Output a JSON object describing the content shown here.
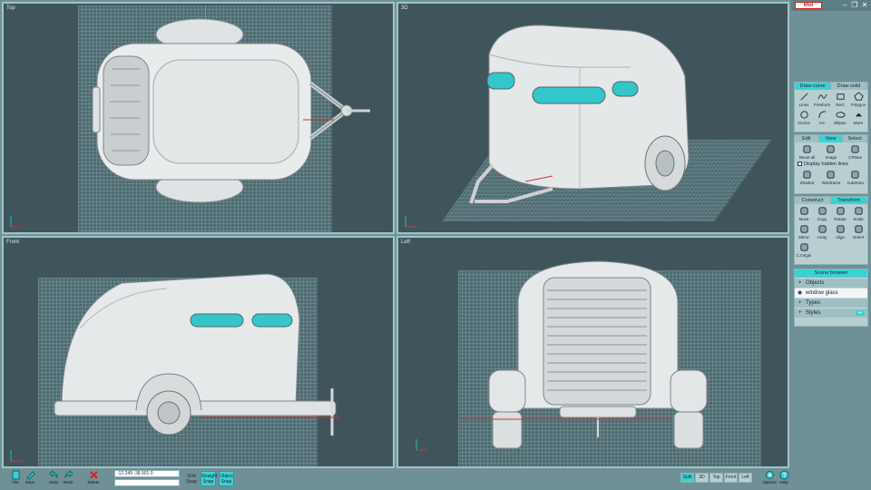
{
  "viewports": {
    "top": {
      "label": "Top"
    },
    "persp": {
      "label": "3D"
    },
    "front": {
      "label": "Front"
    },
    "left": {
      "label": "Left"
    }
  },
  "panel": {
    "app_logo": "MoI",
    "draw_tabs": [
      "Draw curve",
      "Draw solid"
    ],
    "draw_tools": [
      {
        "label": "Lines",
        "icon": "lines-icon"
      },
      {
        "label": "Freeform",
        "icon": "freeform-icon"
      },
      {
        "label": "Rect",
        "icon": "rect-icon"
      },
      {
        "label": "Polygon",
        "icon": "polygon-icon"
      },
      {
        "label": "Circles",
        "icon": "circles-icon"
      },
      {
        "label": "Arc",
        "icon": "arc-icon"
      },
      {
        "label": "Ellipse",
        "icon": "ellipse-icon"
      },
      {
        "label": "More",
        "icon": "more-icon"
      }
    ],
    "view_tabs": [
      "Edit",
      "View",
      "Select"
    ],
    "view_tools": [
      {
        "label": "Reset all",
        "icon": "reset-all-icon"
      },
      {
        "label": "Image",
        "icon": "image-icon"
      },
      {
        "label": "CPlane",
        "icon": "cplane-icon"
      }
    ],
    "display_hidden_lines": "Display hidden lines",
    "render_tools": [
      {
        "label": "Shaded",
        "icon": "shaded-icon"
      },
      {
        "label": "Wireframe",
        "icon": "wireframe-icon"
      },
      {
        "label": "AutoRoto",
        "icon": "autorotate-icon"
      }
    ],
    "transform_tabs": [
      "Construct",
      "Transform"
    ],
    "transform_tools": [
      {
        "label": "Move",
        "icon": "move-icon"
      },
      {
        "label": "Copy",
        "icon": "copy-icon"
      },
      {
        "label": "Rotate",
        "icon": "rotate-icon"
      },
      {
        "label": "Scale",
        "icon": "scale-icon"
      },
      {
        "label": "Mirror",
        "icon": "mirror-icon"
      },
      {
        "label": "Array",
        "icon": "array-icon"
      },
      {
        "label": "Align",
        "icon": "align-icon"
      },
      {
        "label": "Orient",
        "icon": "orient-icon"
      },
      {
        "label": "C.Origin",
        "icon": "c-origin-icon"
      }
    ],
    "scene_browser": {
      "title": "Scene browser",
      "objects": "Objects",
      "selected_item": "window glass",
      "types": "Types",
      "styles": "Styles"
    }
  },
  "bottom": {
    "file": "File",
    "save": "Save",
    "undo": "Undo",
    "redo": "Redo",
    "delete": "Delete",
    "coords": "-12.249   -38.901   0",
    "grid_snap": "Grid Snap",
    "straight_snap": "Straight Snap",
    "object_snap": "Object Snap",
    "view_buttons": [
      "Split",
      "3D",
      "Top",
      "Front",
      "Left"
    ],
    "active_view": "Split",
    "options": "Options",
    "help": "Help"
  },
  "colors": {
    "accent": "#39d3d6",
    "viewport_bg": "#3f555b",
    "panel_bg": "#6f9096"
  }
}
